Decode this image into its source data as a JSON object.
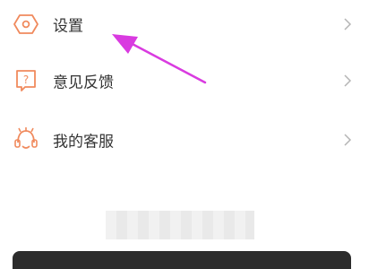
{
  "menu": {
    "items": [
      {
        "label": "设置",
        "icon": "hexagon-gear-icon"
      },
      {
        "label": "意见反馈",
        "icon": "feedback-question-icon"
      },
      {
        "label": "我的客服",
        "icon": "customer-service-icon"
      }
    ]
  },
  "colors": {
    "accent": "#f08a5d",
    "text": "#333333",
    "chevron": "#b5b5b5",
    "annotation": "#d93be0"
  }
}
